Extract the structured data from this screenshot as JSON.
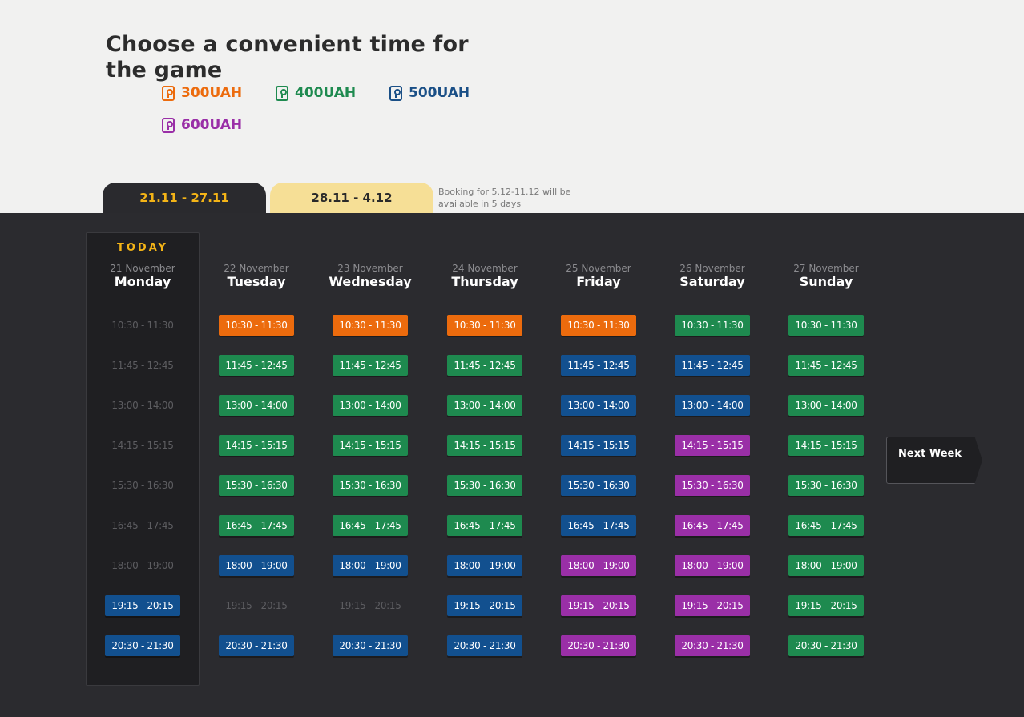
{
  "header": {
    "title": "Choose a convenient time for the game"
  },
  "legend": [
    {
      "label": "300UAH",
      "color": "#ec6b0d",
      "icon": "lock-icon"
    },
    {
      "label": "400UAH",
      "color": "#1e8a4f",
      "icon": "lock-icon"
    },
    {
      "label": "500UAH",
      "color": "#1a4f86",
      "icon": "lock-icon"
    },
    {
      "label": "600UAH",
      "color": "#9a2fa7",
      "icon": "lock-icon"
    }
  ],
  "tabs": [
    {
      "label": "21.11 - 27.11",
      "active": true
    },
    {
      "label": "28.11 - 4.12",
      "active": false
    }
  ],
  "booking_note": "Booking for 5.12-11.12 will be available in 5 days",
  "today_label": "TODAY",
  "colors": {
    "orange": "#ec6b0d",
    "green": "#1e8a4f",
    "blue": "#12508f",
    "purple": "#9a2fa7",
    "board": "#2b2b2f",
    "accent": "#f4b417"
  },
  "days": [
    {
      "date": "21 November",
      "name": "Monday",
      "slots": [
        {
          "time": "10:30 - 11:30",
          "tier": "off"
        },
        {
          "time": "11:45 - 12:45",
          "tier": "off"
        },
        {
          "time": "13:00 - 14:00",
          "tier": "off"
        },
        {
          "time": "14:15 - 15:15",
          "tier": "off"
        },
        {
          "time": "15:30 - 16:30",
          "tier": "off"
        },
        {
          "time": "16:45 - 17:45",
          "tier": "off"
        },
        {
          "time": "18:00 - 19:00",
          "tier": "off"
        },
        {
          "time": "19:15 - 20:15",
          "tier": "blue"
        },
        {
          "time": "20:30 - 21:30",
          "tier": "blue"
        }
      ]
    },
    {
      "date": "22 November",
      "name": "Tuesday",
      "slots": [
        {
          "time": "10:30 - 11:30",
          "tier": "orange"
        },
        {
          "time": "11:45 - 12:45",
          "tier": "green"
        },
        {
          "time": "13:00 - 14:00",
          "tier": "green"
        },
        {
          "time": "14:15 - 15:15",
          "tier": "green"
        },
        {
          "time": "15:30 - 16:30",
          "tier": "green"
        },
        {
          "time": "16:45 - 17:45",
          "tier": "green"
        },
        {
          "time": "18:00 - 19:00",
          "tier": "blue"
        },
        {
          "time": "19:15 - 20:15",
          "tier": "off"
        },
        {
          "time": "20:30 - 21:30",
          "tier": "blue"
        }
      ]
    },
    {
      "date": "23 November",
      "name": "Wednesday",
      "slots": [
        {
          "time": "10:30 - 11:30",
          "tier": "orange"
        },
        {
          "time": "11:45 - 12:45",
          "tier": "green"
        },
        {
          "time": "13:00 - 14:00",
          "tier": "green"
        },
        {
          "time": "14:15 - 15:15",
          "tier": "green"
        },
        {
          "time": "15:30 - 16:30",
          "tier": "green"
        },
        {
          "time": "16:45 - 17:45",
          "tier": "green"
        },
        {
          "time": "18:00 - 19:00",
          "tier": "blue"
        },
        {
          "time": "19:15 - 20:15",
          "tier": "off"
        },
        {
          "time": "20:30 - 21:30",
          "tier": "blue"
        }
      ]
    },
    {
      "date": "24 November",
      "name": "Thursday",
      "slots": [
        {
          "time": "10:30 - 11:30",
          "tier": "orange"
        },
        {
          "time": "11:45 - 12:45",
          "tier": "green"
        },
        {
          "time": "13:00 - 14:00",
          "tier": "green"
        },
        {
          "time": "14:15 - 15:15",
          "tier": "green"
        },
        {
          "time": "15:30 - 16:30",
          "tier": "green"
        },
        {
          "time": "16:45 - 17:45",
          "tier": "green"
        },
        {
          "time": "18:00 - 19:00",
          "tier": "blue"
        },
        {
          "time": "19:15 - 20:15",
          "tier": "blue"
        },
        {
          "time": "20:30 - 21:30",
          "tier": "blue"
        }
      ]
    },
    {
      "date": "25 November",
      "name": "Friday",
      "slots": [
        {
          "time": "10:30 - 11:30",
          "tier": "orange"
        },
        {
          "time": "11:45 - 12:45",
          "tier": "blue"
        },
        {
          "time": "13:00 - 14:00",
          "tier": "blue"
        },
        {
          "time": "14:15 - 15:15",
          "tier": "blue"
        },
        {
          "time": "15:30 - 16:30",
          "tier": "blue"
        },
        {
          "time": "16:45 - 17:45",
          "tier": "blue"
        },
        {
          "time": "18:00 - 19:00",
          "tier": "purple"
        },
        {
          "time": "19:15 - 20:15",
          "tier": "purple"
        },
        {
          "time": "20:30 - 21:30",
          "tier": "purple"
        }
      ]
    },
    {
      "date": "26 November",
      "name": "Saturday",
      "slots": [
        {
          "time": "10:30 - 11:30",
          "tier": "green"
        },
        {
          "time": "11:45 - 12:45",
          "tier": "blue"
        },
        {
          "time": "13:00 - 14:00",
          "tier": "blue"
        },
        {
          "time": "14:15 - 15:15",
          "tier": "purple"
        },
        {
          "time": "15:30 - 16:30",
          "tier": "purple"
        },
        {
          "time": "16:45 - 17:45",
          "tier": "purple"
        },
        {
          "time": "18:00 - 19:00",
          "tier": "purple"
        },
        {
          "time": "19:15 - 20:15",
          "tier": "purple"
        },
        {
          "time": "20:30 - 21:30",
          "tier": "purple"
        }
      ]
    },
    {
      "date": "27 November",
      "name": "Sunday",
      "slots": [
        {
          "time": "10:30 - 11:30",
          "tier": "green"
        },
        {
          "time": "11:45 - 12:45",
          "tier": "green"
        },
        {
          "time": "13:00 - 14:00",
          "tier": "green"
        },
        {
          "time": "14:15 - 15:15",
          "tier": "green"
        },
        {
          "time": "15:30 - 16:30",
          "tier": "green"
        },
        {
          "time": "16:45 - 17:45",
          "tier": "green"
        },
        {
          "time": "18:00 - 19:00",
          "tier": "green"
        },
        {
          "time": "19:15 - 20:15",
          "tier": "green"
        },
        {
          "time": "20:30 - 21:30",
          "tier": "green"
        }
      ]
    }
  ],
  "next_week_label": "Next Week"
}
